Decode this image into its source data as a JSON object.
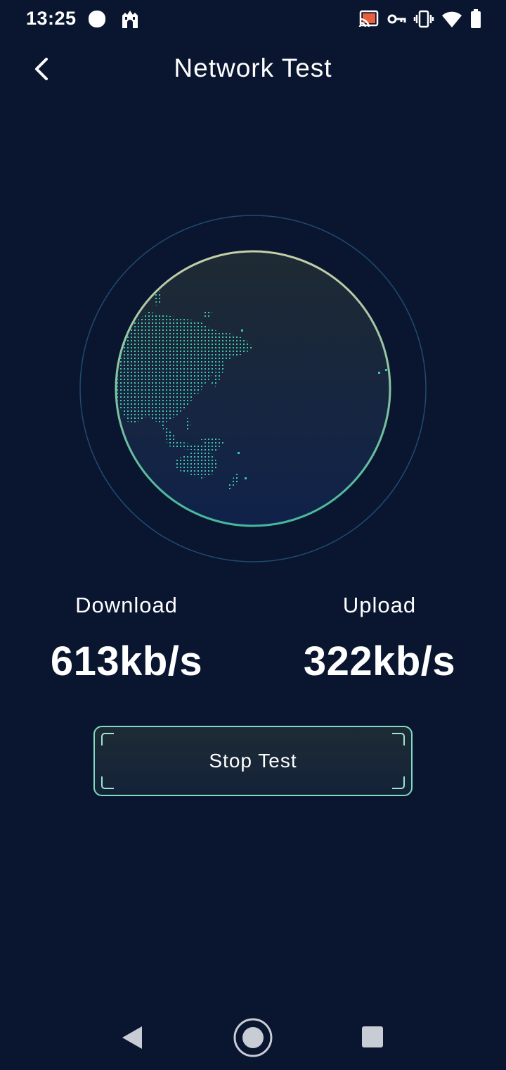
{
  "status_bar": {
    "time": "13:25",
    "left_icons": [
      "circle-notification-icon",
      "fortress-app-icon"
    ],
    "right_icons": [
      "cast-icon",
      "vpn-key-icon",
      "vibrate-icon",
      "wifi-icon",
      "battery-icon"
    ]
  },
  "header": {
    "title": "Network Test",
    "back_icon": "chevron-left-icon"
  },
  "globe": {
    "accent_color": "#4fc4a8",
    "outer_ring_color": "#1f4a72"
  },
  "stats": {
    "download_label": "Download",
    "download_value": "613kb/s",
    "upload_label": "Upload",
    "upload_value": "322kb/s"
  },
  "actions": {
    "stop_label": "Stop Test"
  },
  "nav_bar": {
    "icons": [
      "nav-back-icon",
      "nav-home-icon",
      "nav-recents-icon"
    ]
  },
  "colors": {
    "background": "#0a1630",
    "button_border": "#7fdcc0",
    "text": "#ffffff"
  }
}
